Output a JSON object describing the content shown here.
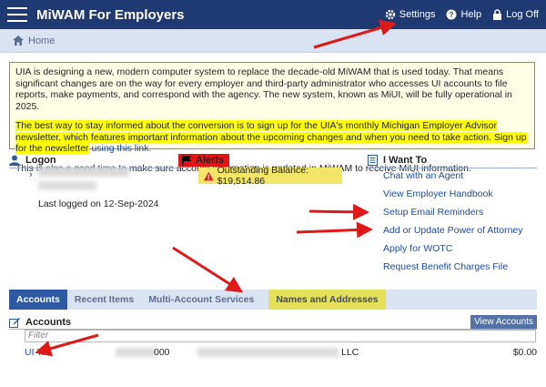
{
  "header": {
    "title": "MiWAM For Employers",
    "settings_label": "Settings",
    "help_label": "Help",
    "logoff_label": "Log Off"
  },
  "breadcrumb": {
    "home_label": "Home"
  },
  "notice": {
    "p1": "UIA is designing a new, modern computer system to replace the decade-old MiWAM that is used today. That means significant changes are on the way for every employer and third-party administrator who accesses UI accounts to file reports, make payments, and correspond with the agency. The new system, known as MiUI, will be fully operational in 2025.",
    "p2": "The best way to stay informed about the conversion is to sign up for the UIA's monthly Michigan Employer Advisor newsletter, which features important information about the upcoming changes and when you need to take action. Sign up for the newsletter",
    "p2_link": "using this link.",
    "p3": "This is also a good time to make sure account information is updated in MiWAM to receive MiUI information."
  },
  "logon": {
    "title": "Logon",
    "last_logged": "Last logged on 12-Sep-2024"
  },
  "alerts": {
    "title": "Alerts",
    "balance": "Outstanding Balance: $19,514.86"
  },
  "iwant": {
    "title": "I Want To",
    "items": [
      "Chat with an Agent",
      "View Employer Handbook",
      "Setup Email Reminders",
      "Add or Update Power of Attorney",
      "Apply for WOTC",
      "Request Benefit Charges File"
    ]
  },
  "tabs": [
    "Accounts",
    "Recent Items",
    "Multi-Account Services",
    "Names and Addresses"
  ],
  "accounts": {
    "title": "Accounts",
    "view_button": "View Accounts",
    "filter_placeholder": "Filter",
    "row": {
      "type": "UI Tax",
      "number_suffix": "000",
      "name_suffix": "LLC",
      "amount": "$0.00"
    }
  },
  "colors": {
    "header_bg": "#1f3a73",
    "highlight": "#ffff00",
    "arrow": "#e01818",
    "link": "#1a4ba8"
  }
}
